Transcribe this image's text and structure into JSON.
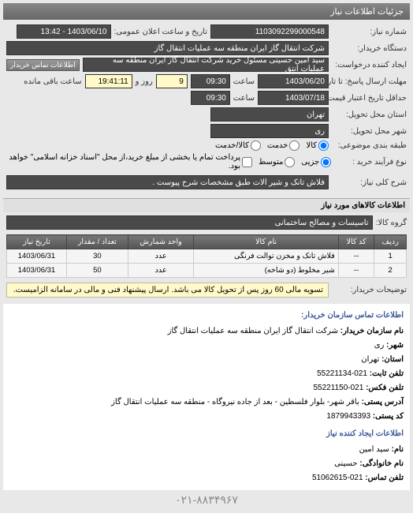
{
  "header": {
    "title": "جزئیات اطلاعات نیاز"
  },
  "form": {
    "number_label": "شماره نیاز:",
    "number_value": "1103092299000548",
    "datetime_label": "تاریخ و ساعت اعلان عمومی:",
    "datetime_value": "1403/06/10 - 13:42",
    "org_label": "دستگاه خریدار:",
    "org_value": "شرکت انتقال گاز ایران منطقه سه عملیات انتقال گاز",
    "creator_label": "ایجاد کننده درخواست:",
    "creator_value": "سید امین حسینی مسئول خرید شرکت انتقال گاز ایران منطقه سه عملیات انتق",
    "contact_btn": "اطلاعات تماس خریدار",
    "resp_deadline_label": "مهلت ارسال پاسخ: تا تاریخ:",
    "resp_deadline_date": "1403/06/20",
    "resp_deadline_time_lbl": "ساعت",
    "resp_deadline_time": "09:30",
    "days_lbl": "روز و",
    "days_value": "9",
    "remain_lbl": "ساعت باقی مانده",
    "remain_value": "19:41:11",
    "validity_label": "حداقل تاریخ اعتبار قیمت: تا تاریخ:",
    "validity_date": "1403/07/18",
    "validity_time_lbl": "ساعت",
    "validity_time": "09:30",
    "province_label": "استان محل تحویل:",
    "province_value": "تهران",
    "city_label": "شهر محل تحویل:",
    "city_value": "ری",
    "category_label": "طبقه بندی موضوعی:",
    "cat_goods": "کالا",
    "cat_service": "خدمت",
    "cat_both": "کالا/خدمت",
    "need_type_label": "نوع فرآیند خرید :",
    "nt_low": "جزیی",
    "nt_mid": "متوسط",
    "nt_note": "پرداخت تمام یا بخشی از مبلغ خرید،از محل \"اسناد خزانه اسلامی\" خواهد بود.",
    "summary_label": "شرح کلی نیاز:",
    "summary_value": "فلاش تانک و شیر الات طبق مشخصات شرح پیوست ."
  },
  "section_items": "اطلاعات کالاهای مورد نیاز",
  "group_label": "گروه کالا:",
  "group_value": "تاسیسات و مصالح ساختمانی",
  "table": {
    "headers": [
      "ردیف",
      "کد کالا",
      "نام کالا",
      "واحد شمارش",
      "تعداد / مقدار",
      "تاریخ نیاز"
    ],
    "rows": [
      [
        "1",
        "--",
        "فلاش تانک و مخزن توالت فرنگی",
        "عدد",
        "30",
        "1403/06/31"
      ],
      [
        "2",
        "--",
        "شیر مخلوط (دو شاخه)",
        "عدد",
        "50",
        "1403/06/31"
      ]
    ]
  },
  "buyer_desc_label": "توضیحات خریدار:",
  "buyer_desc_value": "تسویه مالی 60 روز پس از تحویل کالا می باشد. ارسال پیشنهاد فنی و مالی در سامانه الزامیست.",
  "contact": {
    "title": "اطلاعات تماس سازمان خریدار:",
    "org_lbl": "نام سازمان خریدار:",
    "org_val": "شرکت انتقال گاز ایران منطقه سه عملیات انتقال گاز",
    "city_lbl": "شهر:",
    "city_val": "ری",
    "province_lbl": "استان:",
    "province_val": "تهران",
    "phone_lbl": "تلفن ثابت:",
    "phone_val": "021-55221134",
    "fax_lbl": "تلفن فکس:",
    "fax_val": "021-55221150",
    "address_lbl": "آدرس پستی:",
    "address_val": "باقر شهر- بلوار فلسطین - بعد از جاده نیروگاه - منطقه سه عملیات انتقال گاز",
    "postal_lbl": "کد پستی:",
    "postal_val": "1879943393",
    "creator_section": "اطلاعات ایجاد کننده نیاز",
    "name_lbl": "نام:",
    "name_val": "سید امین",
    "family_lbl": "نام خانوادگی:",
    "family_val": "حسینی",
    "tel_lbl": "تلفن تماس:",
    "tel_val": "021-51062615"
  },
  "footer_phone": "۰۲۱-۸۸۳۴۹۶۷"
}
